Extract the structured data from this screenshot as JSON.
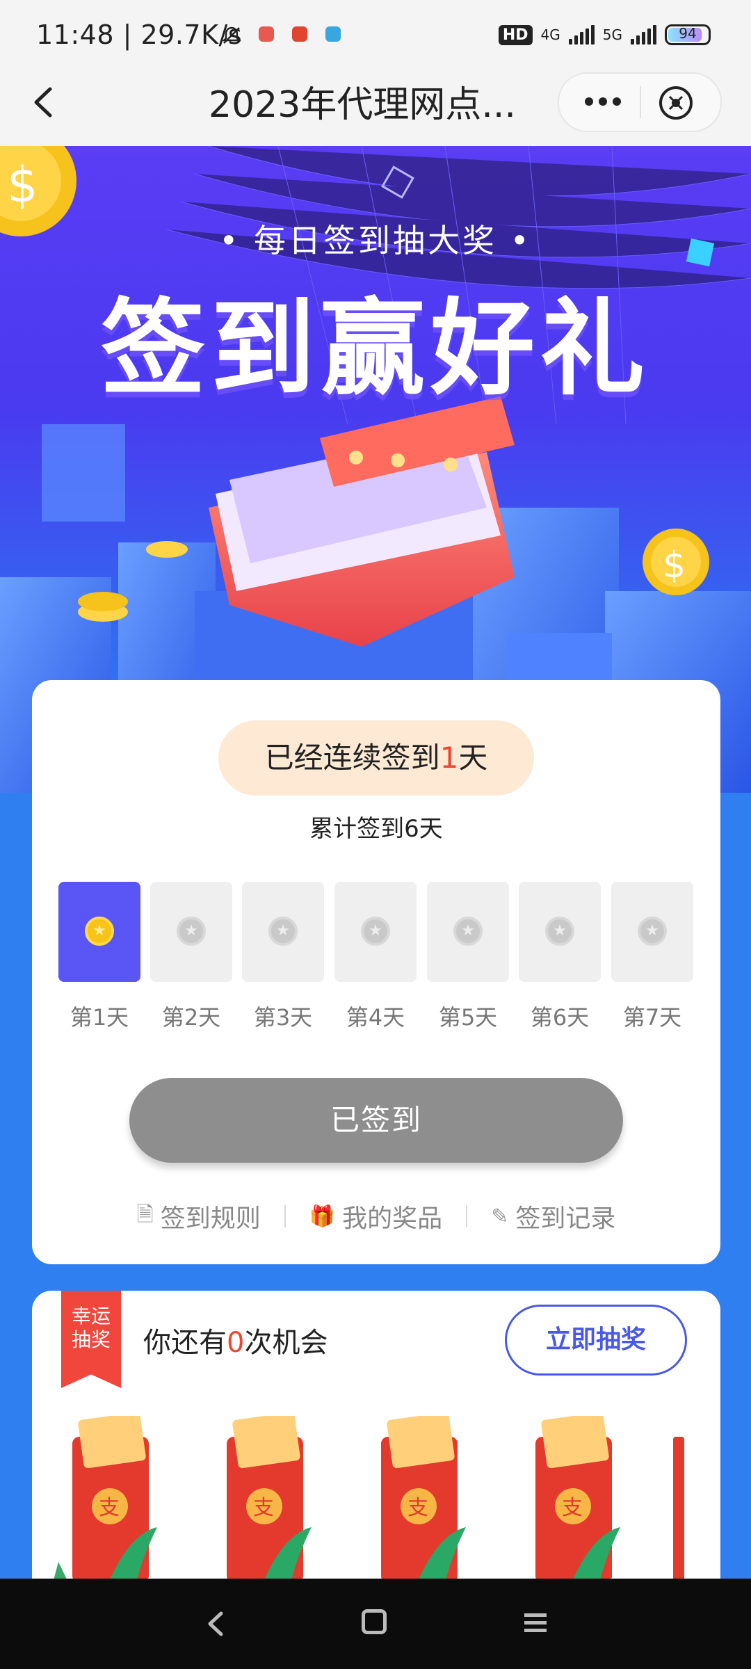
{
  "status": {
    "time": "11:48",
    "speed": "29.7K/s",
    "network_hd": "HD",
    "net1": "4G",
    "net2": "5G",
    "battery": "94"
  },
  "nav": {
    "title": "2023年代理网点...",
    "more_icon": "more-dots-icon",
    "close_icon": "close-circle-icon"
  },
  "hero": {
    "subtitle": "• 每日签到抽大奖 •",
    "title": "签到赢好礼"
  },
  "signin": {
    "streak_prefix": "已经连续签到",
    "streak_count": "1",
    "streak_suffix": "天",
    "total": "累计签到6天",
    "days": [
      {
        "label": "第1天",
        "checked": true
      },
      {
        "label": "第2天",
        "checked": false
      },
      {
        "label": "第3天",
        "checked": false
      },
      {
        "label": "第4天",
        "checked": false
      },
      {
        "label": "第5天",
        "checked": false
      },
      {
        "label": "第6天",
        "checked": false
      },
      {
        "label": "第7天",
        "checked": false
      }
    ],
    "button": "已签到",
    "links": [
      "签到规则",
      "我的奖品",
      "签到记录"
    ]
  },
  "lucky": {
    "ribbon_line1": "幸运",
    "ribbon_line2": "抽奖",
    "chance_prefix": "你还有",
    "chance_count": "0",
    "chance_suffix": "次机会",
    "draw_button": "立即抽奖",
    "envelope_char": "支"
  },
  "colors": {
    "accent": "#5a56f5",
    "red": "#f0462f",
    "draw": "#4a58e8"
  }
}
